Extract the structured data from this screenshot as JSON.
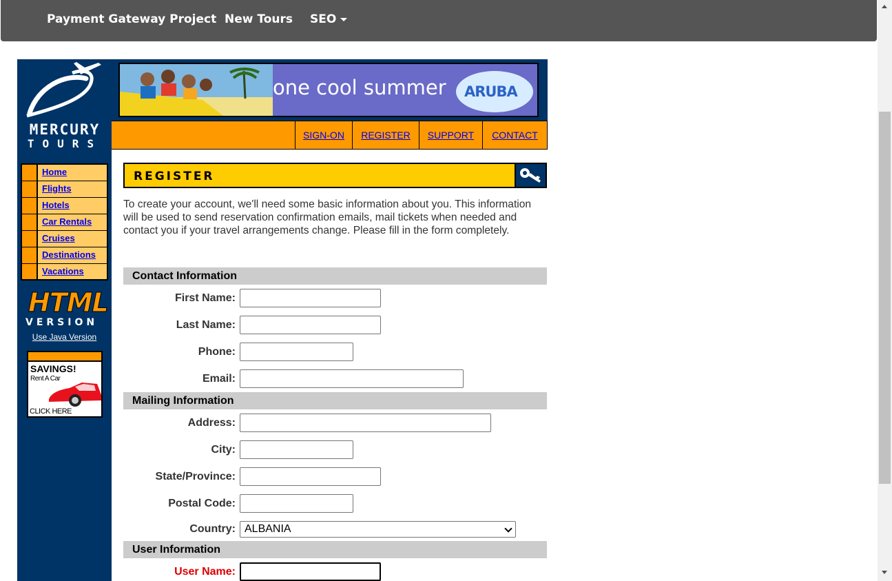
{
  "navbar": {
    "items": [
      {
        "label": "Payment Gateway Project"
      },
      {
        "label": "New Tours"
      },
      {
        "label": "SEO"
      }
    ]
  },
  "logo": {
    "line1": "MERCURY",
    "line2": "TOURS"
  },
  "banner": {
    "text": "one cool summer",
    "brand": "ARUBA"
  },
  "tabs": [
    "SIGN-ON",
    "REGISTER",
    "SUPPORT",
    "CONTACT"
  ],
  "sidenav": [
    "Home",
    "Flights",
    "Hotels",
    "Car Rentals",
    "Cruises",
    "Destinations",
    "Vacations"
  ],
  "html_version": {
    "word1": "HTML",
    "word2": "VERSION",
    "link": "Use Java Version"
  },
  "savings_ad": {
    "title": "SAVINGS!",
    "subtitle": "Rent A Car",
    "cta": "CLICK HERE"
  },
  "register": {
    "title": "REGISTER",
    "intro": "To create your account, we'll need some basic information about you. This information will be used to send reservation confirmation emails, mail tickets when needed and contact you if your travel arrangements change. Please fill in the form completely."
  },
  "sections": {
    "contact": "Contact Information",
    "mailing": "Mailing Information",
    "user": "User Information"
  },
  "fields": {
    "first_name": {
      "label": "First Name:",
      "value": ""
    },
    "last_name": {
      "label": "Last Name:",
      "value": ""
    },
    "phone": {
      "label": "Phone:",
      "value": ""
    },
    "email": {
      "label": "Email:",
      "value": ""
    },
    "address": {
      "label": "Address:",
      "value": ""
    },
    "city": {
      "label": "City:",
      "value": ""
    },
    "state": {
      "label": "State/Province:",
      "value": ""
    },
    "postal": {
      "label": "Postal Code:",
      "value": ""
    },
    "country": {
      "label": "Country:",
      "selected": "ALBANIA"
    },
    "username": {
      "label": "User Name:",
      "value": ""
    }
  },
  "colors": {
    "navbar": "#555555",
    "sidebar": "#003366",
    "orange": "#ff9900",
    "yellow": "#ffcc00",
    "link": "#0000ee",
    "required": "#dd0000"
  }
}
